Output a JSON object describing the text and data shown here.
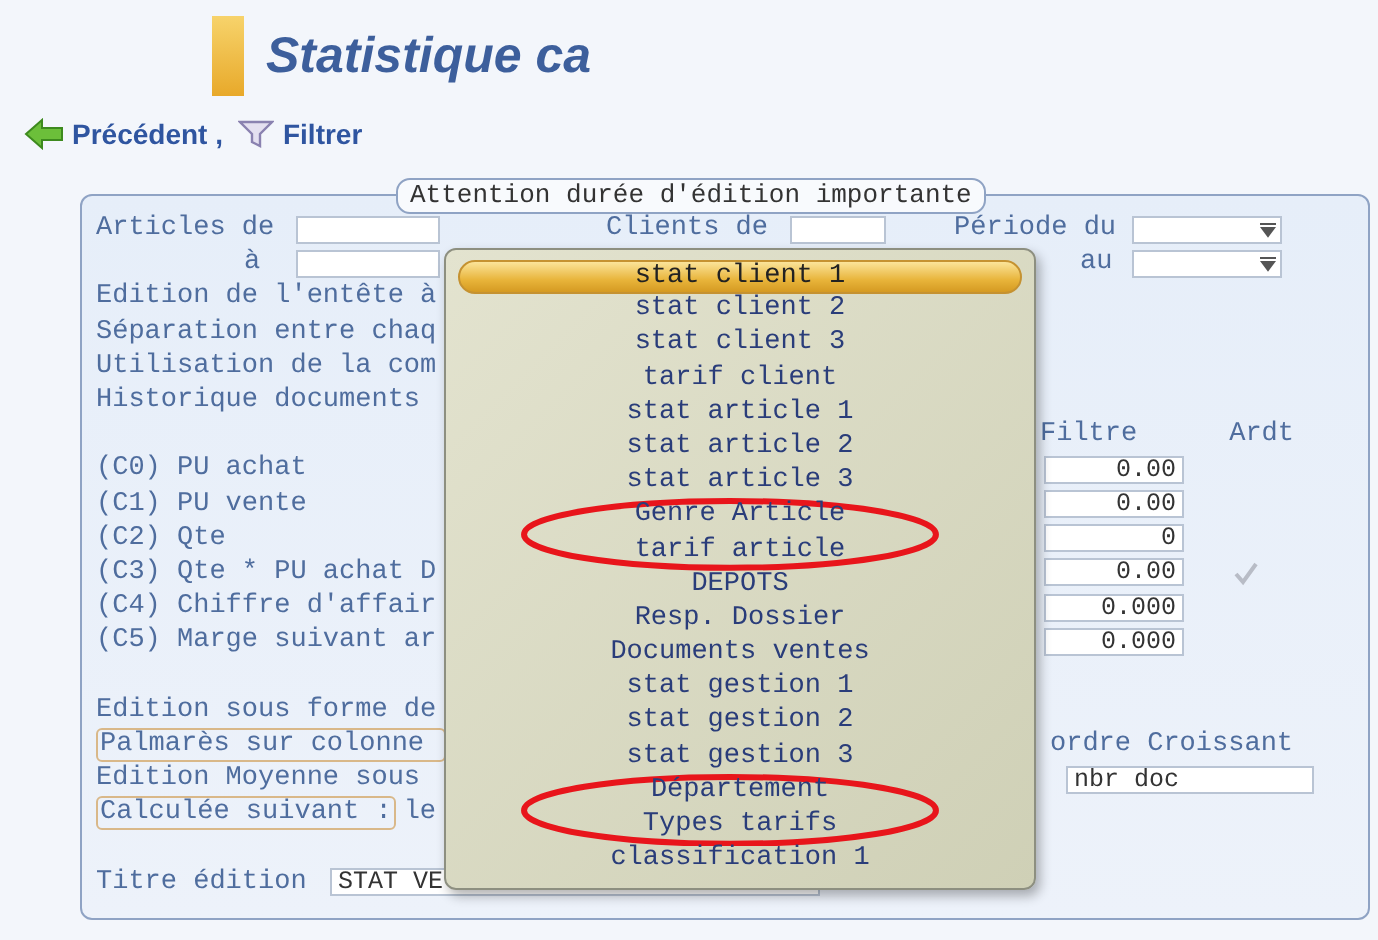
{
  "header": {
    "title": "Statistique ca"
  },
  "toolbar": [
    {
      "kind": "back",
      "label": "Précédent ,"
    },
    {
      "kind": "filter",
      "label": "Filtrer"
    }
  ],
  "panel": {
    "legend": "Attention durée d'édition importante",
    "articles_from_label": "Articles de",
    "articles_to_label": "à",
    "clients_label": "Clients de",
    "period_from_label": "Période du",
    "period_to_label": "au",
    "options": [
      "Edition de l'entête à",
      "Séparation entre chaq",
      "Utilisation de la com",
      "Historique documents"
    ],
    "filter_header": "Filtre",
    "rounding_header": "Ardt",
    "columns": [
      {
        "label": "(C0) PU achat",
        "value": "0.00",
        "rounding": false
      },
      {
        "label": "(C1) PU vente",
        "value": "0.00",
        "rounding": false
      },
      {
        "label": "(C2) Qte",
        "value": "0",
        "rounding": false
      },
      {
        "label": "(C3) Qte * PU achat D",
        "value": "0.00",
        "rounding": true
      },
      {
        "label": "(C4) Chiffre d'affair",
        "value": "0.000",
        "rounding": false
      },
      {
        "label": "(C5) Marge suivant ar",
        "value": "0.000",
        "rounding": false
      }
    ],
    "display": [
      {
        "kind": "plain",
        "label": "Edition sous forme de",
        "framed": false
      },
      {
        "kind": "text",
        "label": "Palmarès sur colonne",
        "framed": true,
        "text": "ordre Croissant"
      },
      {
        "kind": "field",
        "label": "Edition Moyenne sous",
        "framed": false,
        "value": "nbr doc"
      },
      {
        "kind": "suffix",
        "label": "Calculée suivant :",
        "framed": true,
        "text": "le"
      }
    ],
    "title_label": "Titre édition",
    "title_value": "STAT VE"
  },
  "menu": {
    "items": [
      {
        "label": "stat client 1",
        "selected": true,
        "circled": false
      },
      {
        "label": "stat client 2",
        "selected": false,
        "circled": false
      },
      {
        "label": "stat client 3",
        "selected": false,
        "circled": false
      },
      {
        "label": "tarif client",
        "selected": false,
        "circled": false
      },
      {
        "label": "stat article 1",
        "selected": false,
        "circled": false
      },
      {
        "label": "stat article 2",
        "selected": false,
        "circled": false
      },
      {
        "label": "stat article 3",
        "selected": false,
        "circled": false
      },
      {
        "label": "Genre Article",
        "selected": false,
        "circled": true
      },
      {
        "label": "tarif article",
        "selected": false,
        "circled": true
      },
      {
        "label": "DEPOTS",
        "selected": false,
        "circled": false
      },
      {
        "label": "Resp. Dossier",
        "selected": false,
        "circled": false
      },
      {
        "label": "Documents ventes",
        "selected": false,
        "circled": false
      },
      {
        "label": "stat gestion 1",
        "selected": false,
        "circled": false
      },
      {
        "label": "stat gestion 2",
        "selected": false,
        "circled": false
      },
      {
        "label": "stat gestion 3",
        "selected": false,
        "circled": false
      },
      {
        "label": "Département",
        "selected": false,
        "circled": true
      },
      {
        "label": "Types tarifs",
        "selected": false,
        "circled": true
      },
      {
        "label": "classification 1",
        "selected": false,
        "circled": false
      }
    ]
  }
}
